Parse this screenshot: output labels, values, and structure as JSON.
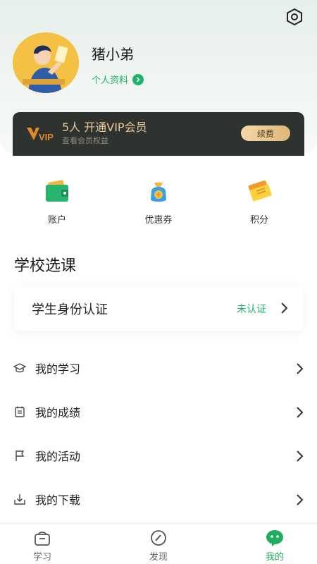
{
  "profile": {
    "username": "猪小弟",
    "profile_link_label": "个人资料"
  },
  "vip": {
    "title": "5人 开通VIP会员",
    "subtitle": "查看会员权益",
    "renew_label": "续费",
    "logo_text": "VIP"
  },
  "quick_actions": [
    {
      "label": "账户",
      "icon": "wallet-icon"
    },
    {
      "label": "优惠券",
      "icon": "coupon-bag-icon"
    },
    {
      "label": "积分",
      "icon": "points-ticket-icon"
    }
  ],
  "section": {
    "title": "学校选课"
  },
  "certification": {
    "label": "学生身份认证",
    "status": "未认证"
  },
  "menu": [
    {
      "label": "我的学习",
      "icon": "graduation-cap-icon"
    },
    {
      "label": "我的成绩",
      "icon": "calendar-icon"
    },
    {
      "label": "我的活动",
      "icon": "flag-icon"
    },
    {
      "label": "我的下载",
      "icon": "download-icon"
    }
  ],
  "tabbar": [
    {
      "label": "学习",
      "icon": "study-bag-icon",
      "active": false
    },
    {
      "label": "发现",
      "icon": "compass-icon",
      "active": false
    },
    {
      "label": "我的",
      "icon": "profile-bubble-icon",
      "active": true
    }
  ],
  "colors": {
    "accent": "#23b06a",
    "vip_bg": "#2f332f",
    "vip_gold": "#e9c79a"
  }
}
